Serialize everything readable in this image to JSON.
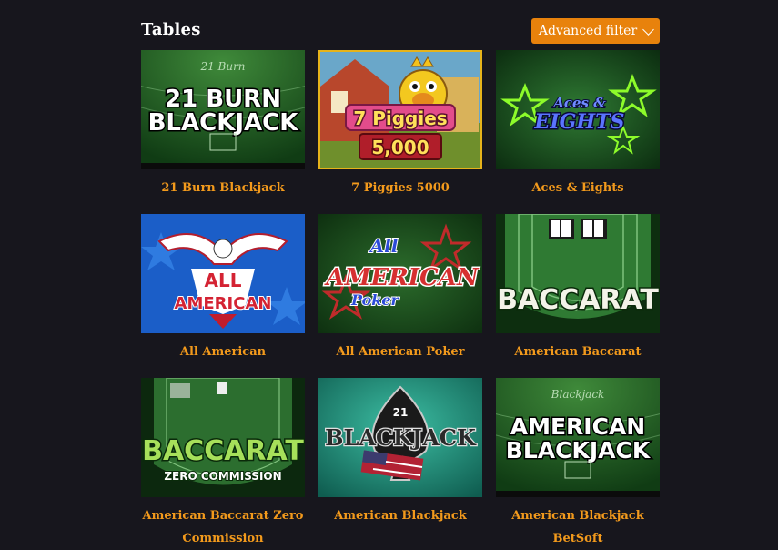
{
  "header": {
    "title": "Tables",
    "filter_label": "Advanced filter"
  },
  "games": [
    {
      "title": "21 Burn Blackjack",
      "thumb_text": [
        "21 BURN",
        "BLACKJACK"
      ],
      "felt_text": "21 Burn"
    },
    {
      "title": "7 Piggies 5000",
      "thumb_text": [
        "7 Piggies",
        "5,000"
      ]
    },
    {
      "title": "Aces & Eights",
      "thumb_text": [
        "Aces &",
        "EIGHTS"
      ]
    },
    {
      "title": "All American",
      "thumb_text": [
        "ALL",
        "AMERICAN"
      ]
    },
    {
      "title": "All American Poker",
      "thumb_text": [
        "All",
        "AMERICAN",
        "Poker"
      ]
    },
    {
      "title": "American Baccarat",
      "thumb_text": [
        "BACCARAT"
      ]
    },
    {
      "title": "American Baccarat Zero Commission",
      "thumb_text": [
        "BACCARAT",
        "ZERO COMMISSION"
      ]
    },
    {
      "title": "American Blackjack",
      "thumb_text": [
        "21",
        "BLACKJACK"
      ]
    },
    {
      "title": "American Blackjack BetSoft",
      "thumb_text": [
        "AMERICAN",
        "BLACKJACK"
      ],
      "felt_text": "Blackjack"
    }
  ],
  "colors": {
    "accent": "#e8820c",
    "label": "#f39a1c",
    "background": "#17161d"
  }
}
